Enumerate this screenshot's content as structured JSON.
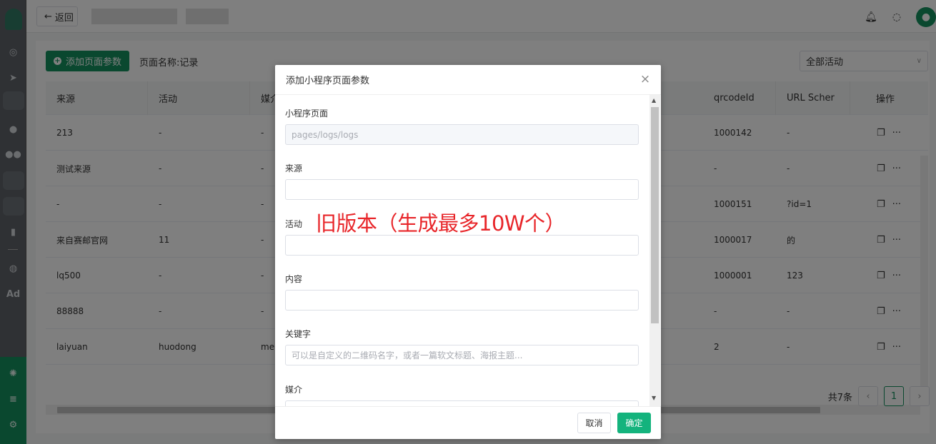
{
  "topbar": {
    "back_label": "返回",
    "back_icon": "arrow-left-icon"
  },
  "toolbar": {
    "add_label": "添加页面参数",
    "page_name": "页面名称:记录",
    "activity_select": "全部活动"
  },
  "table": {
    "headers": [
      "来源",
      "活动",
      "媒介",
      "qrcodeId",
      "URL Scher",
      "操作"
    ],
    "rows": [
      {
        "source": "213",
        "activity": "-",
        "media": "-",
        "qrcode": "1000142",
        "url": "-"
      },
      {
        "source": "测试来源",
        "activity": "-",
        "media": "-",
        "qrcode": "-",
        "url": "-"
      },
      {
        "source": "-",
        "activity": "-",
        "media": "-",
        "qrcode": "1000151",
        "url": "?id=1"
      },
      {
        "source": "来自赛邮官网",
        "activity": "11",
        "media": "-",
        "qrcode": "1000017",
        "url": "的"
      },
      {
        "source": "lq500",
        "activity": "-",
        "media": "-",
        "qrcode": "1000001",
        "url": "123"
      },
      {
        "source": "88888",
        "activity": "-",
        "media": "-",
        "qrcode": "-",
        "url": "-"
      },
      {
        "source": "laiyuan",
        "activity": "huodong",
        "media": "mei",
        "qrcode": "2",
        "url": "-"
      }
    ],
    "op_more": "···"
  },
  "pager": {
    "total": "共7条",
    "current": "1",
    "prev": "‹",
    "next": "›"
  },
  "dialog": {
    "title": "添加小程序页面参数",
    "close": "×",
    "fields": {
      "page_label": "小程序页面",
      "page_value": "pages/logs/logs",
      "source_label": "来源",
      "activity_label": "活动",
      "content_label": "内容",
      "keyword_label": "关键字",
      "keyword_placeholder": "可以是自定义的二维码名字，或者一篇软文标题、海报主题...",
      "media_label": "媒介"
    },
    "cancel": "取消",
    "ok": "确定",
    "annotation": "旧版本（生成最多10W个）"
  },
  "rail": {
    "ad_label": "Ad"
  },
  "colors": {
    "brand": "#14905f",
    "ok_button": "#14b37d",
    "annotation": "#e8262a"
  }
}
